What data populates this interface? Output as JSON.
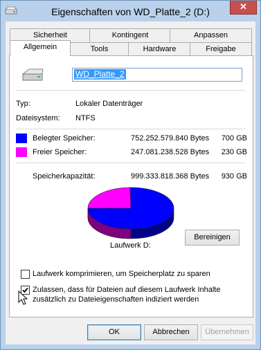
{
  "window": {
    "title": "Eigenschaften von WD_Platte_2 (D:)",
    "close_glyph": "✕"
  },
  "tabs_row1": [
    "Sicherheit",
    "Kontingent",
    "Anpassen"
  ],
  "tabs_row2": [
    "Allgemein",
    "Tools",
    "Hardware",
    "Freigabe"
  ],
  "general": {
    "drive_name": "WD_Platte_2",
    "type_label": "Typ:",
    "type_value": "Lokaler Datenträger",
    "fs_label": "Dateisystem:",
    "fs_value": "NTFS",
    "used_label": "Belegter Speicher:",
    "used_bytes": "752.252.579.840 Bytes",
    "used_gb": "700 GB",
    "free_label": "Freier Speicher:",
    "free_bytes": "247.081.238.528 Bytes",
    "free_gb": "230 GB",
    "capacity_label": "Speicherkapazität:",
    "capacity_bytes": "999.333.818.368 Bytes",
    "capacity_gb": "930 GB",
    "drive_label": "Laufwerk D:",
    "cleanup_button": "Bereinigen",
    "compress_checkbox": "Laufwerk komprimieren, um Speicherplatz zu sparen",
    "compress_checked": false,
    "index_checkbox_line1": "Zulassen, dass für Dateien auf diesem Laufwerk Inhalte",
    "index_checkbox_line2": "zusätzlich zu Dateieigenschaften indiziert werden",
    "index_checked": true,
    "used_color": "#0000ff",
    "free_color": "#ff00ff",
    "used_fraction": 0.753
  },
  "footer": {
    "ok": "OK",
    "cancel": "Abbrechen",
    "apply": "Übernehmen"
  }
}
